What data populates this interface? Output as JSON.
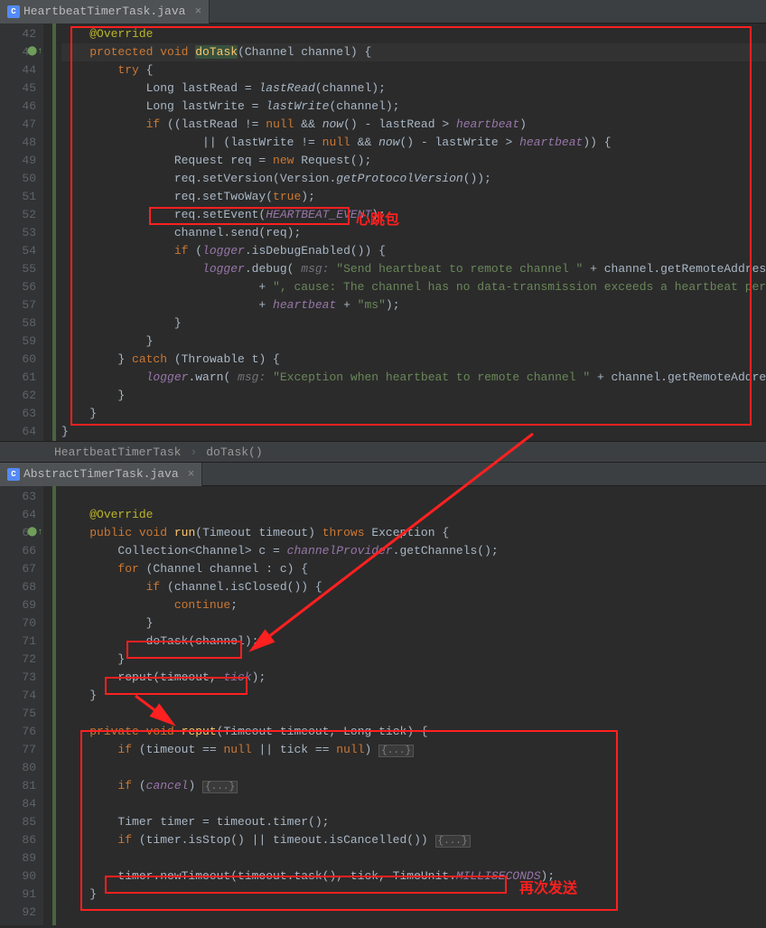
{
  "tabs": {
    "top": "HeartbeatTimerTask.java",
    "bottom": "AbstractTimerTask.java"
  },
  "breadcrumb": {
    "class": "HeartbeatTimerTask",
    "method": "doTask()"
  },
  "annotations": {
    "label1": "心跳包",
    "label2": "再次发送"
  },
  "lines_top": {
    "42": "        @Override",
    "43": "        protected void doTask(Channel channel) {",
    "44": "            try {",
    "45": "                Long lastRead = lastRead(channel);",
    "46": "                Long lastWrite = lastWrite(channel);",
    "47": "                if ((lastRead != null && now() - lastRead > heartbeat)",
    "48": "                        || (lastWrite != null && now() - lastWrite > heartbeat)) {",
    "49": "                    Request req = new Request();",
    "50": "                    req.setVersion(Version.getProtocolVersion());",
    "51": "                    req.setTwoWay(true);",
    "52": "                    req.setEvent(HEARTBEAT_EVENT);",
    "53": "                    channel.send(req);",
    "54": "                    if (logger.isDebugEnabled()) {",
    "55": "                        logger.debug( msg: \"Send heartbeat to remote channel \" + channel.getRemoteAddress()",
    "56": "                                + \", cause: The channel has no data-transmission exceeds a heartbeat period: \"",
    "57": "                                + heartbeat + \"ms\");",
    "58": "                    }",
    "59": "                }",
    "60": "            } catch (Throwable t) {",
    "61": "                logger.warn( msg: \"Exception when heartbeat to remote channel \" + channel.getRemoteAddress(), t);",
    "62": "            }",
    "63": "        }",
    "64": "    }"
  },
  "lines_bottom": {
    "63": "",
    "64": "    @Override",
    "65": "    public void run(Timeout timeout) throws Exception {",
    "66": "        Collection<Channel> c = channelProvider.getChannels();",
    "67": "        for (Channel channel : c) {",
    "68": "            if (channel.isClosed()) {",
    "69": "                continue;",
    "70": "            }",
    "71": "            doTask(channel);",
    "72": "        }",
    "73": "        reput(timeout, tick);",
    "74": "    }",
    "75": "",
    "76": "    private void reput(Timeout timeout, Long tick) {",
    "77": "        if (timeout == null || tick == null) {...}",
    "80": "",
    "81": "        if (cancel) {...}",
    "84": "",
    "85": "        Timer timer = timeout.timer();",
    "86": "        if (timer.isStop() || timeout.isCancelled()) {...}",
    "89": "",
    "90": "        timer.newTimeout(timeout.task(), tick, TimeUnit.MILLISECONDS);",
    "91": "    }",
    "92": ""
  },
  "line_numbers_top": [
    "42",
    "43",
    "44",
    "45",
    "46",
    "47",
    "48",
    "49",
    "50",
    "51",
    "52",
    "53",
    "54",
    "55",
    "56",
    "57",
    "58",
    "59",
    "60",
    "61",
    "62",
    "63",
    "64"
  ],
  "line_numbers_bottom": [
    "63",
    "64",
    "65",
    "66",
    "67",
    "68",
    "69",
    "70",
    "71",
    "72",
    "73",
    "74",
    "75",
    "76",
    "77",
    "80",
    "81",
    "84",
    "85",
    "86",
    "89",
    "90",
    "91",
    "92"
  ]
}
